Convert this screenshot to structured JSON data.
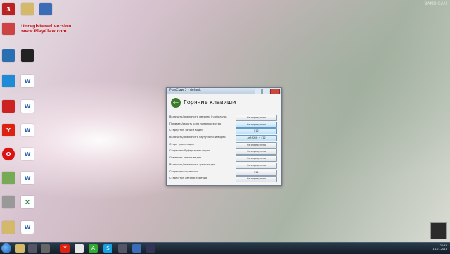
{
  "desktop": {
    "overlay_line1": "Unregistered version",
    "overlay_line2": "www.PlayClaw.com",
    "watermark": "BANDICAM"
  },
  "dialog": {
    "window_title": "PlayClaw 5 - default",
    "heading": "Горячие клавиши",
    "rows": [
      {
        "label": "Включить/выключить оверлеи (глобально)",
        "value": "Не определено"
      },
      {
        "label": "Показать/скрыть окно предпросмотра",
        "value": "Не определено"
      },
      {
        "label": "Старт/стоп записи видео",
        "value": "F12"
      },
      {
        "label": "Включить/выключить паузу записи видео",
        "value": "Left Shift + F12"
      },
      {
        "label": "Старт трансляции",
        "value": "Не определено"
      },
      {
        "label": "Сохранить буфер трансляции",
        "value": "Не определено"
      },
      {
        "label": "Отменить запись видео",
        "value": "Не определено"
      },
      {
        "label": "Включить/выключить трансляцию",
        "value": "Не определено"
      },
      {
        "label": "Сохранить скриншот",
        "value": "F11"
      },
      {
        "label": "Старт/стоп автоповторения",
        "value": "Не определено"
      }
    ]
  },
  "taskbar": {
    "time": "20:44",
    "date": "16.01.2016"
  },
  "colors": {
    "accent_back": "#3b7a2a",
    "selected_value": "#bfe0f6"
  }
}
